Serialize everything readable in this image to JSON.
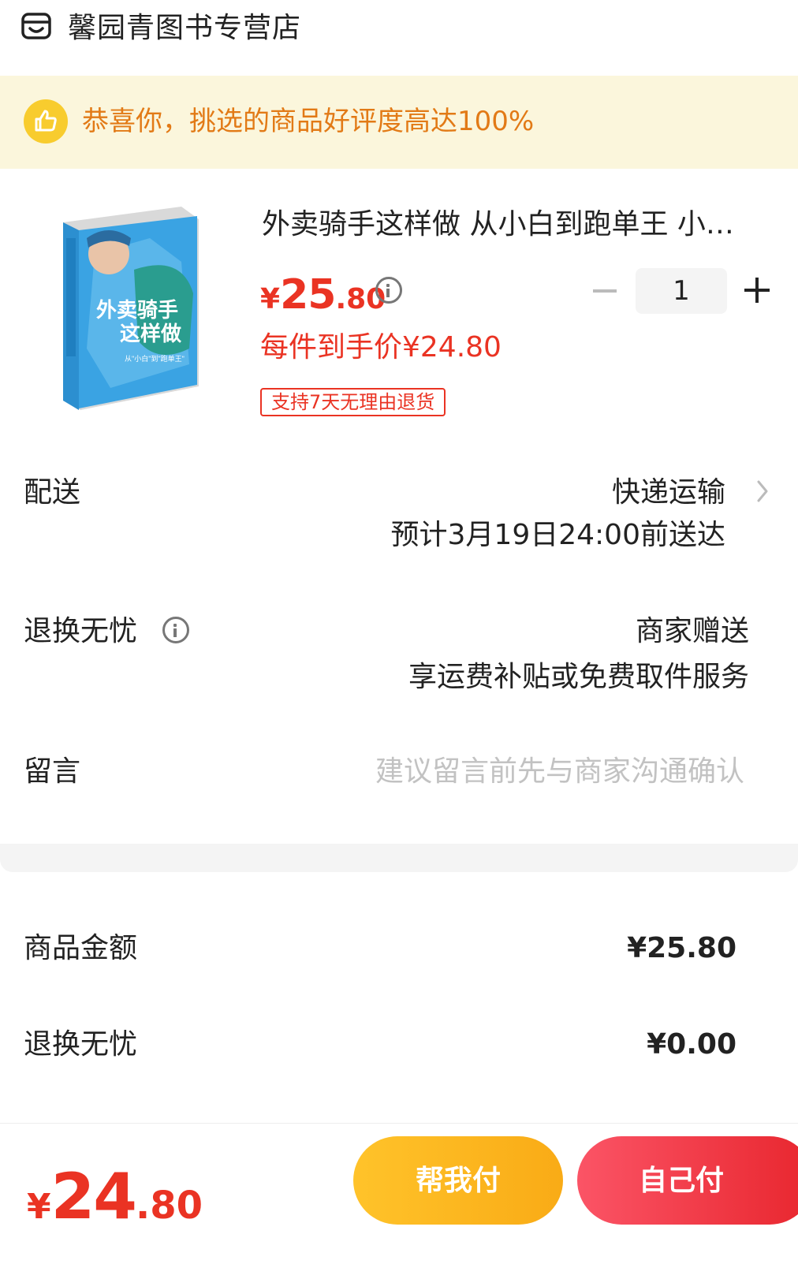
{
  "store": {
    "name": "馨园青图书专营店",
    "icon": "store-icon"
  },
  "banner": {
    "icon": "thumbs-up-icon",
    "text": "恭喜你，挑选的商品好评度高达100%"
  },
  "product": {
    "image_alt": "外卖骑手这样做 book cover",
    "cover_texts": [
      "外卖骑手",
      "这样做",
      "从\"小白\"到\"跑单王\""
    ],
    "title": "外卖骑手这样做 从小白到跑单王 小…",
    "price": {
      "symbol": "¥",
      "integer": "25",
      "decimal": ".80"
    },
    "quantity": "1",
    "unit_price_label": "每件到手价¥24.80",
    "return_tag": "支持7天无理由退货"
  },
  "delivery": {
    "label": "配送",
    "method": "快递运输",
    "eta": "预计3月19日24:00前送达"
  },
  "return_worry_free": {
    "label": "退换无忧",
    "value": "商家赠送",
    "desc": "享运费补贴或免费取件服务"
  },
  "message": {
    "label": "留言",
    "placeholder": "建议留言前先与商家沟通确认"
  },
  "summary": {
    "goods_amount_label": "商品金额",
    "goods_amount": "¥25.80",
    "return_label": "退换无忧",
    "return_amount": "¥0.00"
  },
  "footer": {
    "total": {
      "symbol": "¥",
      "integer": "24",
      "decimal": ".80"
    },
    "help_pay_label": "帮我付",
    "self_pay_label": "自己付"
  },
  "colors": {
    "price_red": "#ea3323",
    "banner_bg": "#fbf6dc",
    "banner_text": "#e27a16",
    "help_pay": "#f9ab16",
    "self_pay": "#e8262e"
  }
}
